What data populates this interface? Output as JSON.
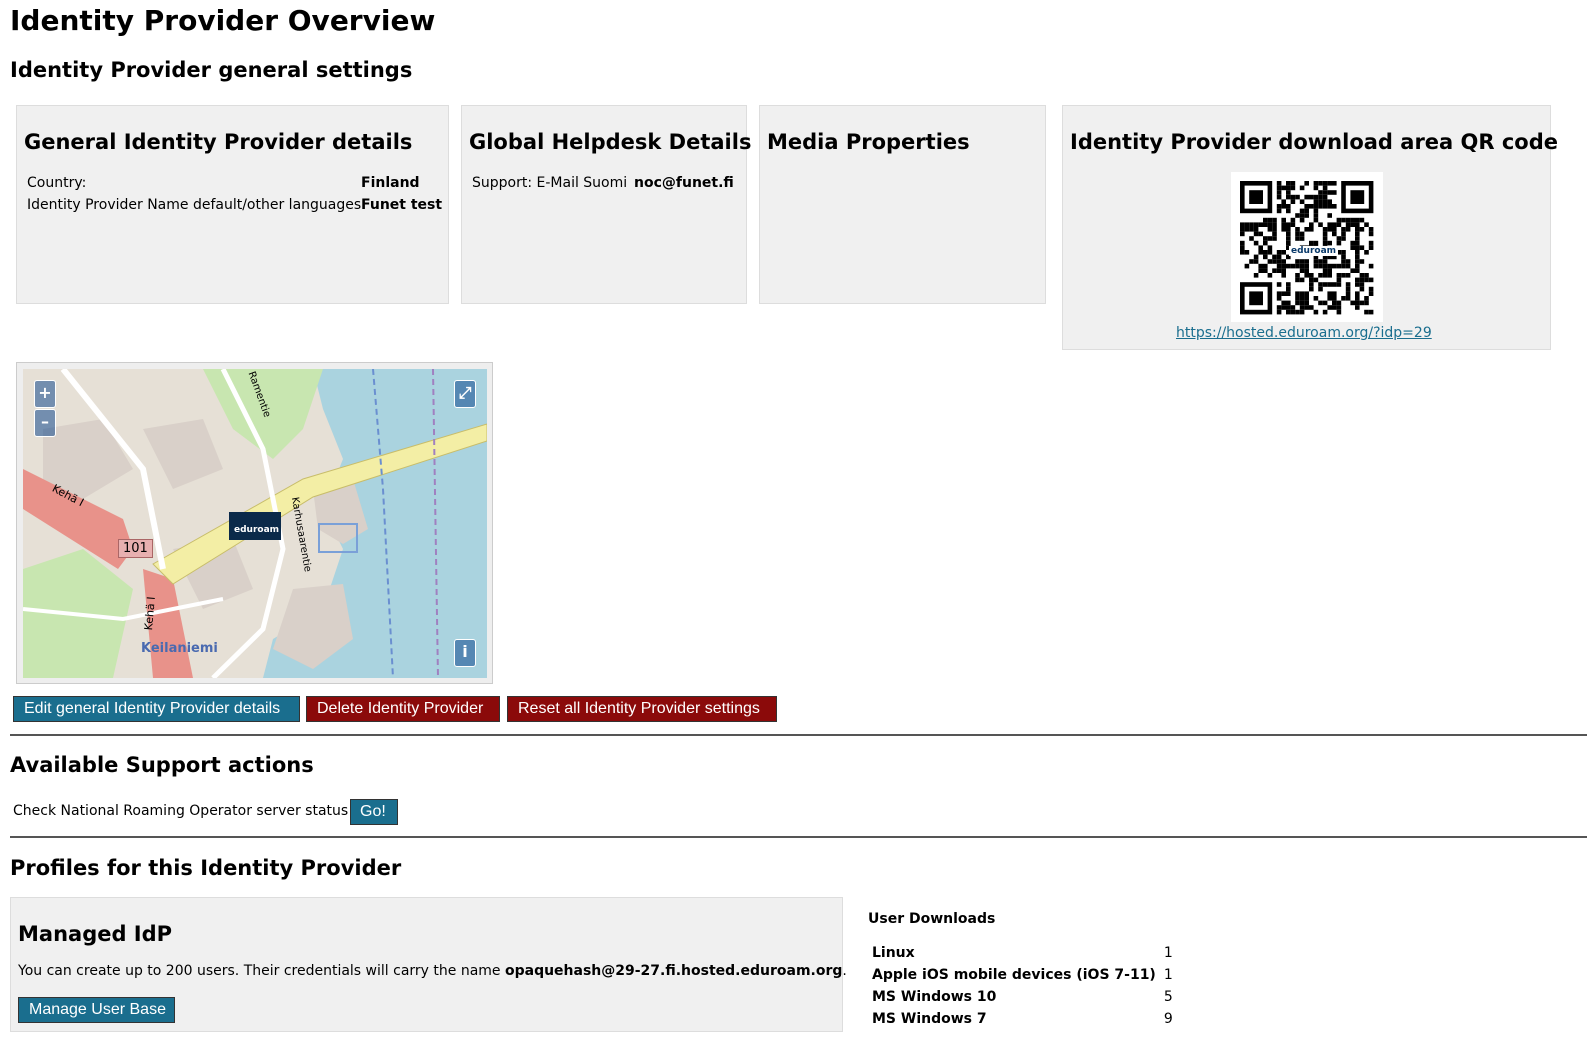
{
  "page": {
    "title": "Identity Provider Overview",
    "general_heading": "Identity Provider general settings"
  },
  "cards": {
    "general": {
      "title": "General Identity Provider details",
      "rows": [
        {
          "label": "Country:",
          "value": "Finland"
        },
        {
          "label": "Identity Provider Name default/other languages",
          "value": "Funet test"
        }
      ]
    },
    "helpdesk": {
      "title": "Global Helpdesk Details",
      "label": "Support: E-Mail Suomi",
      "value": "noc@funet.fi"
    },
    "media": {
      "title": "Media Properties"
    },
    "qr": {
      "title": "Identity Provider download area QR code",
      "logo_text": "eduroam",
      "link": "https://hosted.eduroam.org/?idp=29"
    }
  },
  "map": {
    "zoom_in": "+",
    "zoom_out": "–",
    "fullscreen": "⤢",
    "info": "i",
    "marker_text": "eduroam",
    "labels": {
      "road1": "Kehä I",
      "road2": "Kehä I",
      "route": "101",
      "district": "Keilaniemi",
      "street1": "Ramentie",
      "street2": "Karhusaarentie"
    }
  },
  "actions": {
    "edit": "Edit general Identity Provider details",
    "delete": "Delete Identity Provider",
    "reset": "Reset all Identity Provider settings"
  },
  "support": {
    "heading": "Available Support actions",
    "check_label": "Check National Roaming Operator server status",
    "go": "Go!"
  },
  "profiles": {
    "heading": "Profiles for this Identity Provider",
    "managed": {
      "title": "Managed IdP",
      "text": "You can create up to 200 users. Their credentials will carry the name",
      "realm": "opaquehash@29-27.fi.hosted.eduroam.org",
      "period": ".",
      "button": "Manage User Base"
    },
    "downloads": {
      "heading": "User Downloads",
      "rows": [
        {
          "name": "Linux",
          "count": "1"
        },
        {
          "name": "Apple iOS mobile devices (iOS 7-11)",
          "count": "1"
        },
        {
          "name": "MS Windows 10",
          "count": "5"
        },
        {
          "name": "MS Windows 7",
          "count": "9"
        }
      ]
    }
  },
  "colors": {
    "button_blue": "#1a6e8e",
    "button_red": "#8b0a0a",
    "card_bg": "#f0f0f0"
  }
}
